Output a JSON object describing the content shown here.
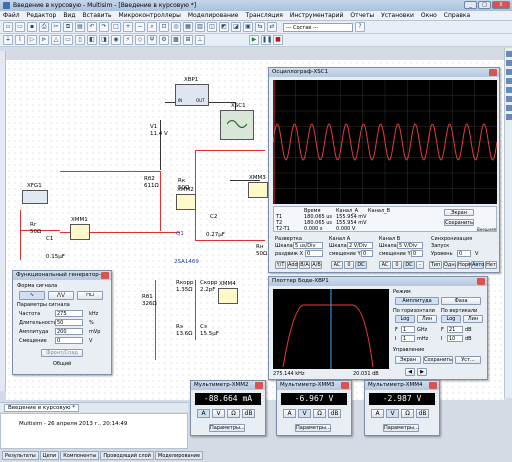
{
  "window": {
    "title": "Введение в курсовую - Multisim - [Введение в курсовую *]",
    "buttons": [
      "_",
      "□",
      "X"
    ]
  },
  "menu": [
    "Файл",
    "Редактор",
    "Вид",
    "Вставить",
    "Микроконтроллеры",
    "Моделирование",
    "Трансляция",
    "Инструментарий",
    "Отчеты",
    "Установки",
    "Окно",
    "Справка"
  ],
  "toolbar": {
    "combo_value": "--- Состав ---",
    "sim_buttons": [
      "▶",
      "❚❚",
      "■"
    ]
  },
  "schematic": {
    "xbp1": "XBP1",
    "xsc1": "XSC1",
    "xfg1": "XFG1",
    "xmm1": "XMM1",
    "xmm2": "XMM2",
    "xmm3": "XMM3",
    "xmm4": "XMM4",
    "v1": "V1",
    "v1_val": "11.4 V",
    "rg": "Rг",
    "rg_val": "50Ω",
    "rb2": "Rб2",
    "rb2_val": "611Ω",
    "rk": "Rк",
    "rk_val": "50Ω",
    "c1": "C1",
    "c1_val": "0.15µF",
    "c2": "C2",
    "c2_val": "0.27µF",
    "q1": "Q1",
    "q1_model": "2SA1469",
    "rn": "Rн",
    "rn_val": "50Ω",
    "rb1": "Rб1",
    "rb1_val": "326Ω",
    "rkorr": "Rкорр",
    "rkorr_val": "1.35Ω",
    "ckorr": "Cкорр",
    "ckorr_val": "2.2pF",
    "re": "Rэ",
    "re_val": "13.6Ω",
    "ce": "Cэ",
    "ce_val": "15.5µF",
    "in_label": "IN",
    "out_label": "OUT"
  },
  "funcgen": {
    "title": "Функциональный генератор-...",
    "section_waveform": "Форма сигнала",
    "section_params": "Параметры сигнала",
    "rows": [
      {
        "label": "Частота",
        "value": "275",
        "unit": "kHz"
      },
      {
        "label": "Длительность",
        "value": "50",
        "unit": "%"
      },
      {
        "label": "Амплитуда",
        "value": "200",
        "unit": "mVp"
      },
      {
        "label": "Смещение",
        "value": "0",
        "unit": "V"
      }
    ],
    "rise_fall": "Фронт/Спад",
    "common": "Общий"
  },
  "scope": {
    "title": "Осциллограф-XSC1",
    "cursor_headers": [
      "Время",
      "Канал_A",
      "Канал_B"
    ],
    "t1": {
      "label": "T1",
      "time": "180.065 us",
      "a": "155.954 mV",
      "b": ""
    },
    "t2": {
      "label": "T2",
      "time": "180.065 us",
      "a": "155.954 mV",
      "b": ""
    },
    "t21": {
      "label": "T2-T1",
      "time": "0.000 s",
      "a": "0.000 V",
      "b": ""
    },
    "reverse": "Экран",
    "save": "Сохранить",
    "ext": "Внешняя",
    "timebase": {
      "title": "Развертка",
      "scale_label": "Шкала",
      "scale": "5 us/Div",
      "pos_label": "раздвиж X",
      "pos": "0"
    },
    "cha": {
      "title": "Канал A",
      "scale_label": "Шкала",
      "scale": "2 V/Div",
      "pos_label": "смещение Y",
      "pos": "0"
    },
    "chb": {
      "title": "Канал B",
      "scale_label": "Шкала",
      "scale": "5 V/Div",
      "pos_label": "смещение Y",
      "pos": "0"
    },
    "trigger": {
      "title": "Синхронизация",
      "edge_label": "Запуск",
      "level_label": "Уровень",
      "level": "0",
      "unit": "V"
    },
    "mode_buttons_tb": [
      "Y/T",
      "Add",
      "B/A",
      "A/B"
    ],
    "mode_buttons_a": [
      "AC",
      "0",
      "DC"
    ],
    "mode_buttons_b": [
      "AC",
      "0",
      "DC",
      "-"
    ],
    "trig_buttons": [
      "Тип",
      "Одн.",
      "Норм.",
      "Авто",
      "Нет"
    ]
  },
  "bode": {
    "title": "Плоттер Боде-XBP1",
    "mode_title": "Режим",
    "amp": "Амплитуда",
    "phase": "Фаза",
    "horiz": "По горизонтали",
    "vert": "По вертикали",
    "log": "Log",
    "lin": "Лин",
    "f_label": "F",
    "f_val": "1",
    "f_unit": "GHz",
    "i_label": "I",
    "i_val": "1",
    "i_unit": "mHz",
    "vf_val": "21",
    "vf_unit": "dB",
    "vi_val": "10",
    "vi_unit": "dB",
    "control": "Управление",
    "reverse": "Экран",
    "save": "Сохранить",
    "set": "Уст...",
    "readout_left": "275.144 kHz",
    "readout_right": "20.031 dB"
  },
  "mm2": {
    "title": "Мультиметр-XMM2",
    "value": "-88.664 mA",
    "btns": [
      "A",
      "V",
      "Ω",
      "dB"
    ],
    "settings": "Параметры..."
  },
  "mm3": {
    "title": "Мультиметр-XMM3",
    "value": "-6.967 V",
    "btns": [
      "A",
      "V",
      "Ω",
      "dB"
    ],
    "settings": "Параметры..."
  },
  "mm4": {
    "title": "Мультиметр-XMM4",
    "value": "-2.987 V",
    "btns": [
      "A",
      "V",
      "Ω",
      "dB"
    ],
    "settings": "Параметры..."
  },
  "bottom": {
    "doc_tab": "Введение в курсовую *",
    "log_text": "Multisim  -  26 апреля 2013 г., 20:14:49",
    "tabs": [
      "Результаты",
      "Цепи",
      "Компоненты",
      "Проводящий слой",
      "Моделирование"
    ]
  }
}
